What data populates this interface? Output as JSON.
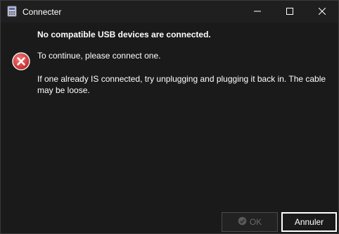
{
  "window": {
    "title": "Connecter",
    "icons": {
      "app": "calculator-icon",
      "minimize": "minimize-icon",
      "maximize": "maximize-icon",
      "close": "close-icon"
    }
  },
  "dialog": {
    "icon": "error-icon",
    "main_instruction": "No compatible USB devices are connected.",
    "message_line1": "To continue, please connect one.",
    "message_line2": "If one already IS connected, try unplugging and plugging it back in. The cable may be loose."
  },
  "buttons": {
    "ok_label": "OK",
    "ok_icon": "checkmark-circle-icon",
    "cancel_label": "Annuler"
  },
  "colors": {
    "background": "#1a1a1a",
    "error_red": "#d93c3c",
    "disabled_text": "#6a6a6a"
  }
}
